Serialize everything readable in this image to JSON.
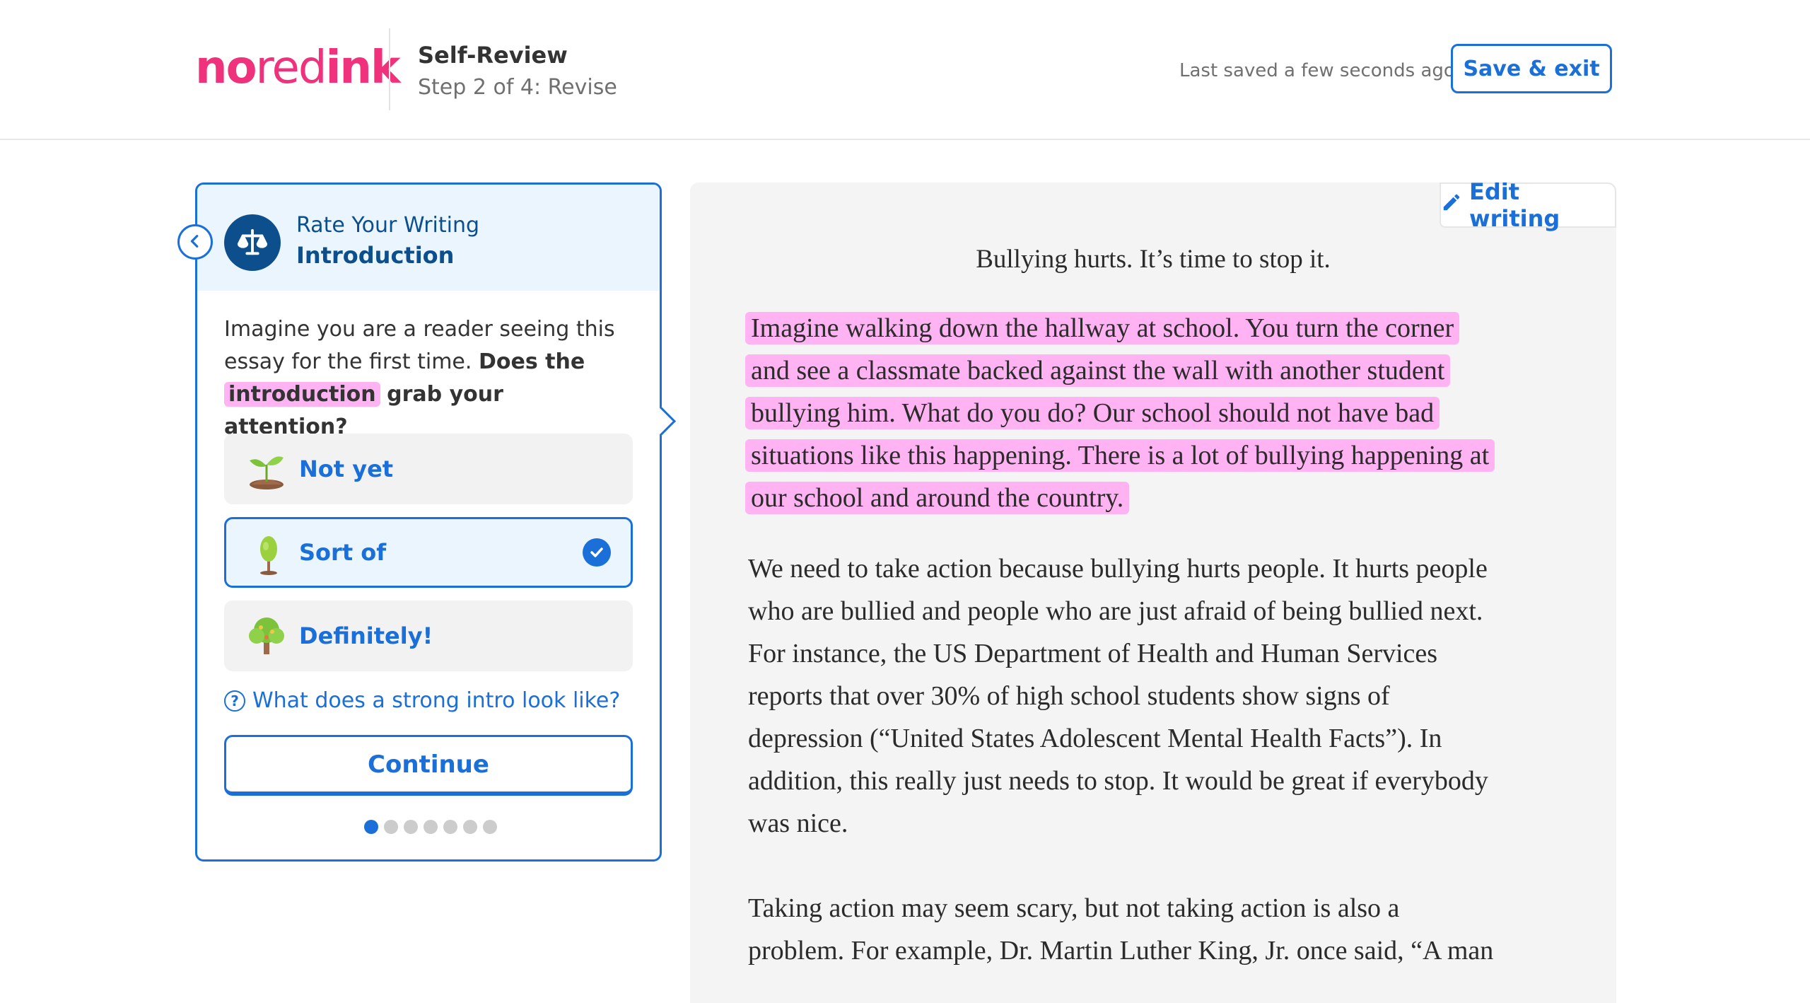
{
  "header": {
    "logo_parts": [
      "no",
      "red",
      "ink"
    ],
    "title": "Self-Review",
    "step": "Step 2 of 4: Revise",
    "saved_status": "Last saved a few seconds ago",
    "save_exit_label": "Save & exit"
  },
  "panel": {
    "subtitle": "Rate Your Writing",
    "title": "Introduction",
    "prompt_start": "Imagine you are a reader seeing this essay for the first time.",
    "prompt_bold": "Does the",
    "prompt_highlight": "introduction",
    "prompt_end": "grab your attention?",
    "options": [
      {
        "label": "Not yet",
        "icon": "sprout-icon",
        "selected": false
      },
      {
        "label": "Sort of",
        "icon": "sapling-icon",
        "selected": true
      },
      {
        "label": "Definitely!",
        "icon": "tree-icon",
        "selected": false
      }
    ],
    "help_link": "What does a strong intro look like?",
    "continue_label": "Continue",
    "progress": {
      "current": 1,
      "total": 7
    }
  },
  "essay": {
    "edit_label": "Edit writing",
    "title": "Bullying hurts. It’s time to stop it.",
    "intro_lines": [
      "Imagine walking down the hallway at school. You turn the corner",
      "and see a classmate backed against the wall with another student",
      "bullying him. What do you do? Our school should not have bad",
      "situations like this happening. There is a lot of bullying happening at",
      "our school and around the country."
    ],
    "body1_lines": [
      "We need to take action because bullying hurts people. It hurts people",
      "who are bullied and people who are just afraid of being bullied next.",
      "For instance, the US Department of Health and Human Services",
      "reports that over 30% of high school students show signs of",
      "depression (“United States Adolescent Mental Health Facts”). In",
      "addition, this really just needs to stop. It would be great if everybody",
      "was nice."
    ],
    "body2_lines": [
      "Taking action may seem scary, but not taking action is also a",
      "problem. For example, Dr. Martin Luther King, Jr. once said, “A man"
    ]
  },
  "colors": {
    "accent_blue": "#1a6fd8",
    "navy": "#0d4f8d",
    "brand_pink": "#f0317c",
    "highlight_pink": "#ffb3f3"
  }
}
